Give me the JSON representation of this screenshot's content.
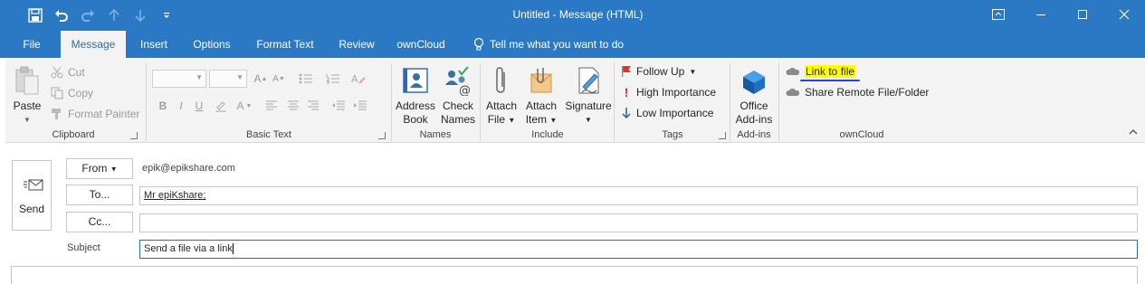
{
  "window": {
    "title": "Untitled  -  Message (HTML)"
  },
  "qat": [
    "save-icon",
    "undo-icon",
    "redo-icon",
    "up-arrow-icon",
    "down-arrow-icon",
    "customize-icon"
  ],
  "tabs": [
    {
      "label": "File",
      "active": false
    },
    {
      "label": "Message",
      "active": true
    },
    {
      "label": "Insert",
      "active": false
    },
    {
      "label": "Options",
      "active": false
    },
    {
      "label": "Format Text",
      "active": false
    },
    {
      "label": "Review",
      "active": false
    },
    {
      "label": "ownCloud",
      "active": false
    }
  ],
  "tell_me": "Tell me what you want to do",
  "ribbon": {
    "clipboard": {
      "label": "Clipboard",
      "paste": "Paste",
      "cut": "Cut",
      "copy": "Copy",
      "format_painter": "Format Painter"
    },
    "basic_text": {
      "label": "Basic Text"
    },
    "names": {
      "label": "Names",
      "address_book_1": "Address",
      "address_book_2": "Book",
      "check_names_1": "Check",
      "check_names_2": "Names"
    },
    "include": {
      "label": "Include",
      "attach_file_1": "Attach",
      "attach_file_2": "File",
      "attach_item_1": "Attach",
      "attach_item_2": "Item",
      "signature": "Signature"
    },
    "tags": {
      "label": "Tags",
      "follow_up": "Follow Up",
      "high": "High Importance",
      "low": "Low Importance"
    },
    "addins": {
      "label": "Add-ins",
      "office_1": "Office",
      "office_2": "Add-ins"
    },
    "owncloud": {
      "label": "ownCloud",
      "link_to_file": "Link to file",
      "share_remote": "Share Remote File/Folder"
    }
  },
  "header": {
    "send": "Send",
    "from_button": "From",
    "from_value": "epik@epikshare.com",
    "to_button": "To...",
    "to_value": "Mr epiKshare;",
    "cc_button": "Cc...",
    "cc_value": "",
    "subject_label": "Subject",
    "subject_value": "Send a file via a link"
  },
  "colors": {
    "accent": "#2b79c5",
    "highlight": "#ffff00"
  }
}
